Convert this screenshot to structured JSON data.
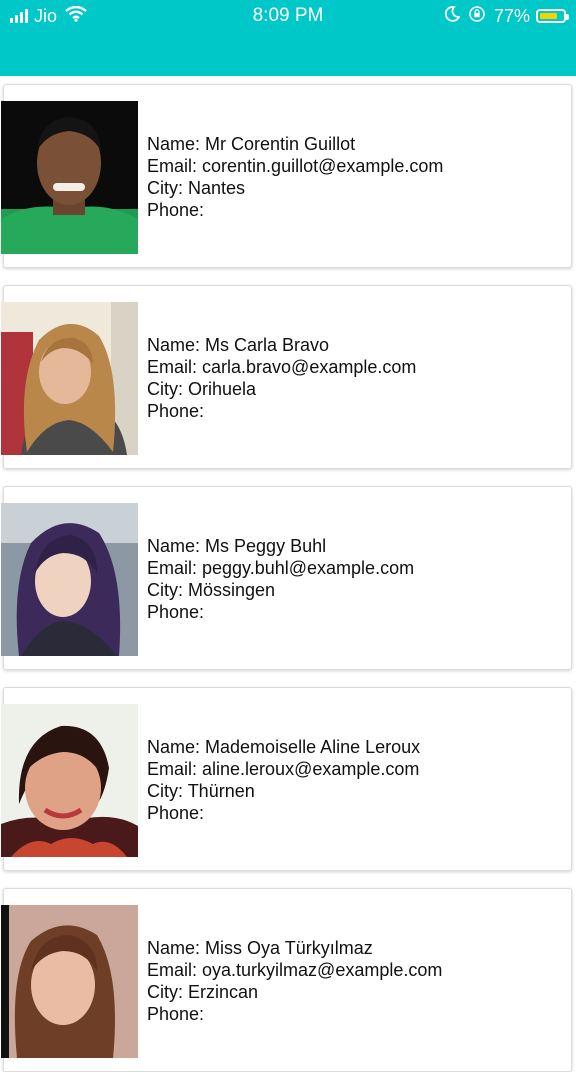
{
  "status_bar": {
    "carrier": "Jio",
    "time": "8:09 PM",
    "battery_percent": "77%",
    "battery_level": 0.77,
    "icons": [
      "signal-icon",
      "wifi-icon",
      "moon-icon",
      "orientation-lock-icon",
      "battery-icon"
    ]
  },
  "labels": {
    "name": "Name: ",
    "email": "Email: ",
    "city": "City: ",
    "phone": "Phone:"
  },
  "contacts": [
    {
      "name": "Mr Corentin Guillot",
      "email": "corentin.guillot@example.com",
      "city": "Nantes",
      "phone": ""
    },
    {
      "name": "Ms Carla Bravo",
      "email": "carla.bravo@example.com",
      "city": "Orihuela",
      "phone": ""
    },
    {
      "name": "Ms Peggy Buhl",
      "email": "peggy.buhl@example.com",
      "city": "Mössingen",
      "phone": ""
    },
    {
      "name": "Mademoiselle Aline Leroux",
      "email": "aline.leroux@example.com",
      "city": "Thürnen",
      "phone": ""
    },
    {
      "name": "Miss Oya Türkyılmaz",
      "email": "oya.turkyilmaz@example.com",
      "city": "Erzincan",
      "phone": ""
    }
  ],
  "colors": {
    "header": "#00c8c8",
    "battery_fill": "#f5d300"
  }
}
